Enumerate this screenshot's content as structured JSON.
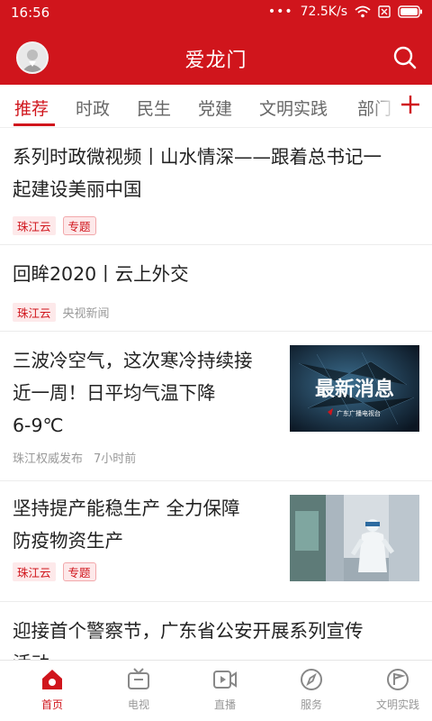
{
  "status_bar": {
    "time": "16:56",
    "speed": "72.5K/s"
  },
  "header": {
    "title": "爱龙门"
  },
  "tabs": [
    {
      "label": "推荐"
    },
    {
      "label": "时政"
    },
    {
      "label": "民生"
    },
    {
      "label": "党建"
    },
    {
      "label": "文明实践"
    },
    {
      "label": "部门"
    }
  ],
  "articles": [
    {
      "line1": "系列时政微视频丨山水情深——跟着总书记一",
      "line2": "起建设美丽中国",
      "source": "珠江云",
      "tag": "专题"
    },
    {
      "line1": "回眸2020丨云上外交",
      "source": "珠江云",
      "extra": "央视新闻"
    },
    {
      "line1": "三波冷空气，这次寒冷持续接",
      "line2": "近一周！日平均气温下降",
      "line3": "6-9℃",
      "source": "珠江权威发布",
      "time": "7小时前",
      "thumb_text": "最新消息",
      "thumb_caption": "广东广播电视台"
    },
    {
      "line1": "坚持提产能稳生产 全力保障",
      "line2": "防疫物资生产",
      "source": "珠江云",
      "tag": "专题"
    },
    {
      "line1": "迎接首个警察节，广东省公安开展系列宣传",
      "line2": "活动"
    }
  ],
  "bottom_nav": [
    {
      "label": "首页"
    },
    {
      "label": "电视"
    },
    {
      "label": "直播"
    },
    {
      "label": "服务"
    },
    {
      "label": "文明实践"
    }
  ],
  "colors": {
    "brand": "#d0151c"
  }
}
